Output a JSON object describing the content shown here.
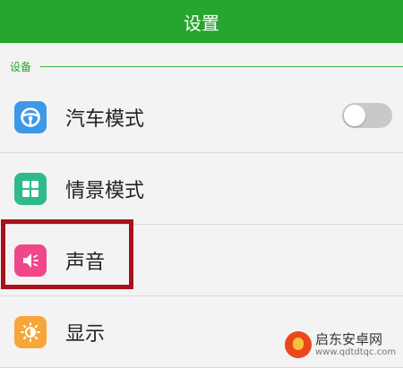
{
  "title_bar": {
    "title": "设置"
  },
  "section": {
    "label": "设备"
  },
  "items": [
    {
      "label": "汽车模式",
      "icon": "steering-wheel-icon",
      "icon_color": "#3e98e8",
      "has_toggle": true,
      "toggle_on": false
    },
    {
      "label": "情景模式",
      "icon": "grid-icon",
      "icon_color": "#2dbb8c"
    },
    {
      "label": "声音",
      "icon": "speaker-icon",
      "icon_color": "#f0468a"
    },
    {
      "label": "显示",
      "icon": "brightness-icon",
      "icon_color": "#f6a63a"
    }
  ],
  "highlight_color": "#a8111b",
  "accent_color": "#27a52e",
  "watermark": {
    "title": "启东安卓网",
    "url": "www.qdtdtqc.com"
  }
}
